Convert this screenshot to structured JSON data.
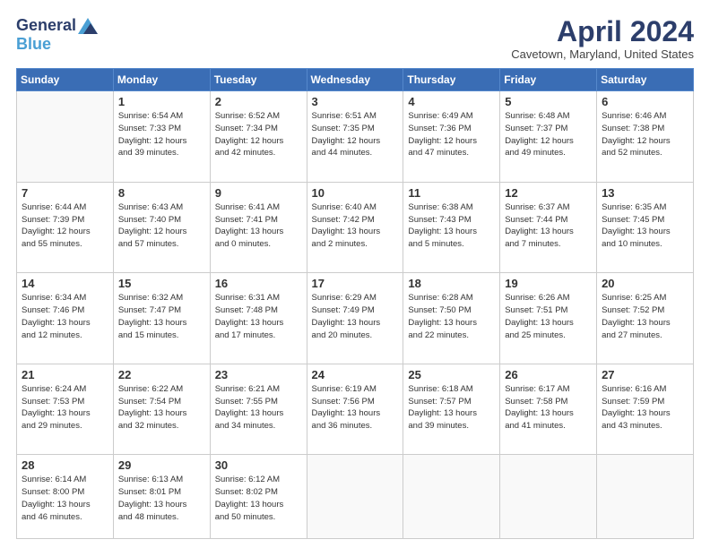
{
  "logo": {
    "general": "General",
    "blue": "Blue"
  },
  "title": "April 2024",
  "subtitle": "Cavetown, Maryland, United States",
  "weekdays": [
    "Sunday",
    "Monday",
    "Tuesday",
    "Wednesday",
    "Thursday",
    "Friday",
    "Saturday"
  ],
  "weeks": [
    [
      {
        "day": "",
        "sunrise": "",
        "sunset": "",
        "daylight": ""
      },
      {
        "day": "1",
        "sunrise": "Sunrise: 6:54 AM",
        "sunset": "Sunset: 7:33 PM",
        "daylight": "Daylight: 12 hours and 39 minutes."
      },
      {
        "day": "2",
        "sunrise": "Sunrise: 6:52 AM",
        "sunset": "Sunset: 7:34 PM",
        "daylight": "Daylight: 12 hours and 42 minutes."
      },
      {
        "day": "3",
        "sunrise": "Sunrise: 6:51 AM",
        "sunset": "Sunset: 7:35 PM",
        "daylight": "Daylight: 12 hours and 44 minutes."
      },
      {
        "day": "4",
        "sunrise": "Sunrise: 6:49 AM",
        "sunset": "Sunset: 7:36 PM",
        "daylight": "Daylight: 12 hours and 47 minutes."
      },
      {
        "day": "5",
        "sunrise": "Sunrise: 6:48 AM",
        "sunset": "Sunset: 7:37 PM",
        "daylight": "Daylight: 12 hours and 49 minutes."
      },
      {
        "day": "6",
        "sunrise": "Sunrise: 6:46 AM",
        "sunset": "Sunset: 7:38 PM",
        "daylight": "Daylight: 12 hours and 52 minutes."
      }
    ],
    [
      {
        "day": "7",
        "sunrise": "Sunrise: 6:44 AM",
        "sunset": "Sunset: 7:39 PM",
        "daylight": "Daylight: 12 hours and 55 minutes."
      },
      {
        "day": "8",
        "sunrise": "Sunrise: 6:43 AM",
        "sunset": "Sunset: 7:40 PM",
        "daylight": "Daylight: 12 hours and 57 minutes."
      },
      {
        "day": "9",
        "sunrise": "Sunrise: 6:41 AM",
        "sunset": "Sunset: 7:41 PM",
        "daylight": "Daylight: 13 hours and 0 minutes."
      },
      {
        "day": "10",
        "sunrise": "Sunrise: 6:40 AM",
        "sunset": "Sunset: 7:42 PM",
        "daylight": "Daylight: 13 hours and 2 minutes."
      },
      {
        "day": "11",
        "sunrise": "Sunrise: 6:38 AM",
        "sunset": "Sunset: 7:43 PM",
        "daylight": "Daylight: 13 hours and 5 minutes."
      },
      {
        "day": "12",
        "sunrise": "Sunrise: 6:37 AM",
        "sunset": "Sunset: 7:44 PM",
        "daylight": "Daylight: 13 hours and 7 minutes."
      },
      {
        "day": "13",
        "sunrise": "Sunrise: 6:35 AM",
        "sunset": "Sunset: 7:45 PM",
        "daylight": "Daylight: 13 hours and 10 minutes."
      }
    ],
    [
      {
        "day": "14",
        "sunrise": "Sunrise: 6:34 AM",
        "sunset": "Sunset: 7:46 PM",
        "daylight": "Daylight: 13 hours and 12 minutes."
      },
      {
        "day": "15",
        "sunrise": "Sunrise: 6:32 AM",
        "sunset": "Sunset: 7:47 PM",
        "daylight": "Daylight: 13 hours and 15 minutes."
      },
      {
        "day": "16",
        "sunrise": "Sunrise: 6:31 AM",
        "sunset": "Sunset: 7:48 PM",
        "daylight": "Daylight: 13 hours and 17 minutes."
      },
      {
        "day": "17",
        "sunrise": "Sunrise: 6:29 AM",
        "sunset": "Sunset: 7:49 PM",
        "daylight": "Daylight: 13 hours and 20 minutes."
      },
      {
        "day": "18",
        "sunrise": "Sunrise: 6:28 AM",
        "sunset": "Sunset: 7:50 PM",
        "daylight": "Daylight: 13 hours and 22 minutes."
      },
      {
        "day": "19",
        "sunrise": "Sunrise: 6:26 AM",
        "sunset": "Sunset: 7:51 PM",
        "daylight": "Daylight: 13 hours and 25 minutes."
      },
      {
        "day": "20",
        "sunrise": "Sunrise: 6:25 AM",
        "sunset": "Sunset: 7:52 PM",
        "daylight": "Daylight: 13 hours and 27 minutes."
      }
    ],
    [
      {
        "day": "21",
        "sunrise": "Sunrise: 6:24 AM",
        "sunset": "Sunset: 7:53 PM",
        "daylight": "Daylight: 13 hours and 29 minutes."
      },
      {
        "day": "22",
        "sunrise": "Sunrise: 6:22 AM",
        "sunset": "Sunset: 7:54 PM",
        "daylight": "Daylight: 13 hours and 32 minutes."
      },
      {
        "day": "23",
        "sunrise": "Sunrise: 6:21 AM",
        "sunset": "Sunset: 7:55 PM",
        "daylight": "Daylight: 13 hours and 34 minutes."
      },
      {
        "day": "24",
        "sunrise": "Sunrise: 6:19 AM",
        "sunset": "Sunset: 7:56 PM",
        "daylight": "Daylight: 13 hours and 36 minutes."
      },
      {
        "day": "25",
        "sunrise": "Sunrise: 6:18 AM",
        "sunset": "Sunset: 7:57 PM",
        "daylight": "Daylight: 13 hours and 39 minutes."
      },
      {
        "day": "26",
        "sunrise": "Sunrise: 6:17 AM",
        "sunset": "Sunset: 7:58 PM",
        "daylight": "Daylight: 13 hours and 41 minutes."
      },
      {
        "day": "27",
        "sunrise": "Sunrise: 6:16 AM",
        "sunset": "Sunset: 7:59 PM",
        "daylight": "Daylight: 13 hours and 43 minutes."
      }
    ],
    [
      {
        "day": "28",
        "sunrise": "Sunrise: 6:14 AM",
        "sunset": "Sunset: 8:00 PM",
        "daylight": "Daylight: 13 hours and 46 minutes."
      },
      {
        "day": "29",
        "sunrise": "Sunrise: 6:13 AM",
        "sunset": "Sunset: 8:01 PM",
        "daylight": "Daylight: 13 hours and 48 minutes."
      },
      {
        "day": "30",
        "sunrise": "Sunrise: 6:12 AM",
        "sunset": "Sunset: 8:02 PM",
        "daylight": "Daylight: 13 hours and 50 minutes."
      },
      {
        "day": "",
        "sunrise": "",
        "sunset": "",
        "daylight": ""
      },
      {
        "day": "",
        "sunrise": "",
        "sunset": "",
        "daylight": ""
      },
      {
        "day": "",
        "sunrise": "",
        "sunset": "",
        "daylight": ""
      },
      {
        "day": "",
        "sunrise": "",
        "sunset": "",
        "daylight": ""
      }
    ]
  ]
}
